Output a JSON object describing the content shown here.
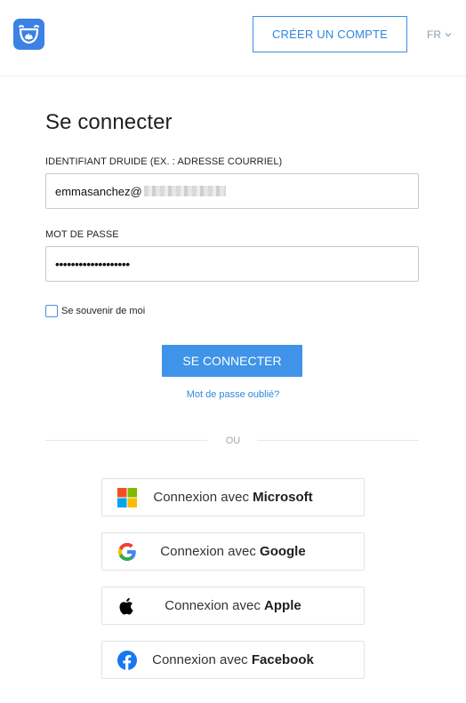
{
  "header": {
    "create_account": "CRÉER UN COMPTE",
    "language": "FR"
  },
  "form": {
    "title": "Se connecter",
    "identifier_label": "IDENTIFIANT DRUIDE (EX. : ADRESSE COURRIEL)",
    "identifier_value": "emmasanchez@",
    "password_label": "MOT DE PASSE",
    "password_value": "•••••••••••••••••••",
    "remember_label": "Se souvenir de moi",
    "submit_label": "SE CONNECTER",
    "forgot_link": "Mot de passe oublié?"
  },
  "divider": {
    "label": "OU"
  },
  "social": [
    {
      "prefix": "Connexion avec ",
      "provider": "Microsoft",
      "icon": "microsoft-icon"
    },
    {
      "prefix": "Connexion avec ",
      "provider": "Google",
      "icon": "google-icon"
    },
    {
      "prefix": "Connexion avec ",
      "provider": "Apple",
      "icon": "apple-icon"
    },
    {
      "prefix": "Connexion avec ",
      "provider": "Facebook",
      "icon": "facebook-icon"
    }
  ],
  "colors": {
    "accent": "#3f93e8",
    "link": "#2d87de",
    "logo": "#3b82e4",
    "facebook": "#1877f2"
  }
}
